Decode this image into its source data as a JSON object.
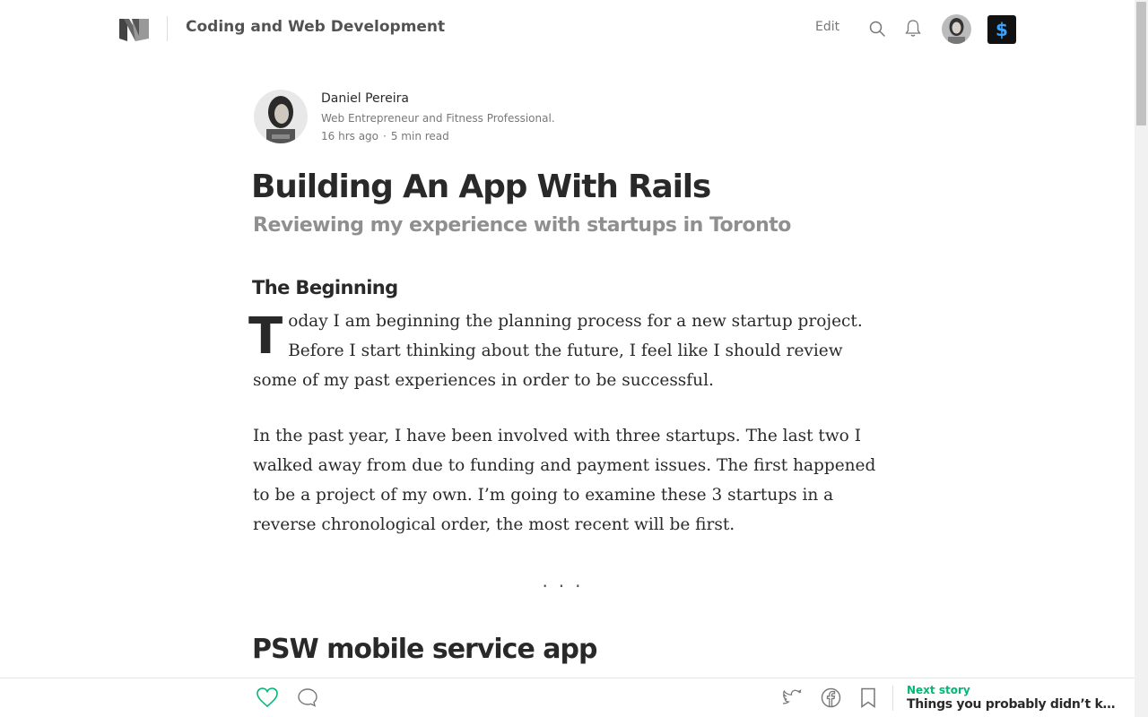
{
  "header": {
    "publication": "Coding and Web Development",
    "edit_label": "Edit",
    "avatar_icon": "user-avatar",
    "upgrade_icon": "dollar-icon",
    "upgrade_symbol": "$",
    "accent": "#3aa3ff"
  },
  "author": {
    "name": "Daniel Pereira",
    "bio": "Web Entrepreneur and Fitness Professional.",
    "time": "16 hrs ago",
    "separator": "·",
    "read_time": "5 min read"
  },
  "article": {
    "title": "Building An App With Rails",
    "subtitle": "Reviewing my experience with startups in Toronto",
    "section1": "The Beginning",
    "p1_dropcap": "T",
    "p1_rest": "oday I am beginning the planning process for a new startup project. Before I start thinking about the future, I feel like I should review some of my past experiences in order to be successful.",
    "p2": "In the past year, I have been involved with three startups. The last two I walked away from due to funding and payment issues. The first happened to be a project of my own. I’m going to examine these 3 startups in a reverse chronological order, the most recent will be first.",
    "separator": "...",
    "section2": "PSW mobile service app"
  },
  "footer": {
    "next_label": "Next story",
    "next_title": "Things you probably didn’t know about Ruby",
    "accent": "#02b875"
  }
}
